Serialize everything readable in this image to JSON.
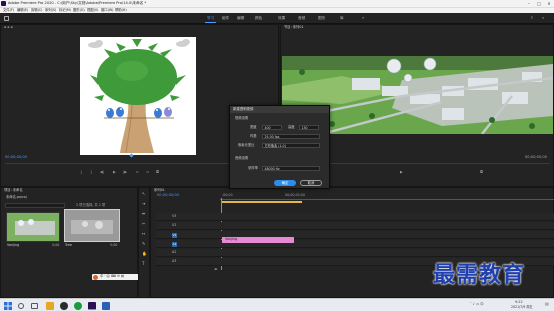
{
  "titlebar": {
    "title": "Adobe Premiere Pro 2020 - C:\\用户\\Sky\\文档\\Adobe\\Premiere Pro\\14.0\\未命名 *"
  },
  "menu": [
    "文件(F)",
    "编辑(E)",
    "剪辑(C)",
    "序列(S)",
    "标记(M)",
    "图形(G)",
    "视图(V)",
    "窗口(W)",
    "帮助(H)"
  ],
  "workspace_tabs": [
    "学习",
    "组件",
    "编辑",
    "颜色",
    "效果",
    "音频",
    "图形",
    "库"
  ],
  "source_monitor": {
    "timecode": "00;00;00;00"
  },
  "program_monitor": {
    "title": "节目: 序列01",
    "timecode_left": "00;00;00;00",
    "timecode_right": "00;00;05;00"
  },
  "dialog": {
    "title": "新建透明视频",
    "video_section": "视频设置",
    "width_label": "宽度",
    "width_value": "400",
    "height_label": "高度",
    "height_value": "130",
    "timebase_label": "时基",
    "timebase_value": "25.00 fps",
    "pixel_label": "像素长宽比",
    "pixel_value": "方形像素 (1.0)",
    "audio_section": "音频设置",
    "sample_label": "采样率",
    "sample_value": "48000 Hz",
    "ok": "确定",
    "cancel": "取消"
  },
  "project": {
    "title": "项目: 未命名",
    "file": "未命名.prproj",
    "items_count": "2 项已选择, 共 2 项",
    "clips": [
      {
        "name": "Vanjing",
        "duration": "5;00"
      },
      {
        "name": "Tree",
        "duration": "5;00"
      }
    ]
  },
  "timeline": {
    "title": "序列01",
    "timecode": "00;00;00;00",
    "ruler_left": ";00;00",
    "ruler_right": "00;00;05;00",
    "tracks": [
      "V3",
      "V2",
      "V1",
      "A1",
      "A2",
      "A3"
    ],
    "clip_label": "Vanjing"
  },
  "watermark": "最需教育",
  "taskbar": {
    "time": "9:22",
    "date": "2021/7/9 周五"
  },
  "colors": {
    "accent": "#4b9cff",
    "clip_pink": "#e58ad5",
    "dialog_ok": "#2d8ceb"
  }
}
